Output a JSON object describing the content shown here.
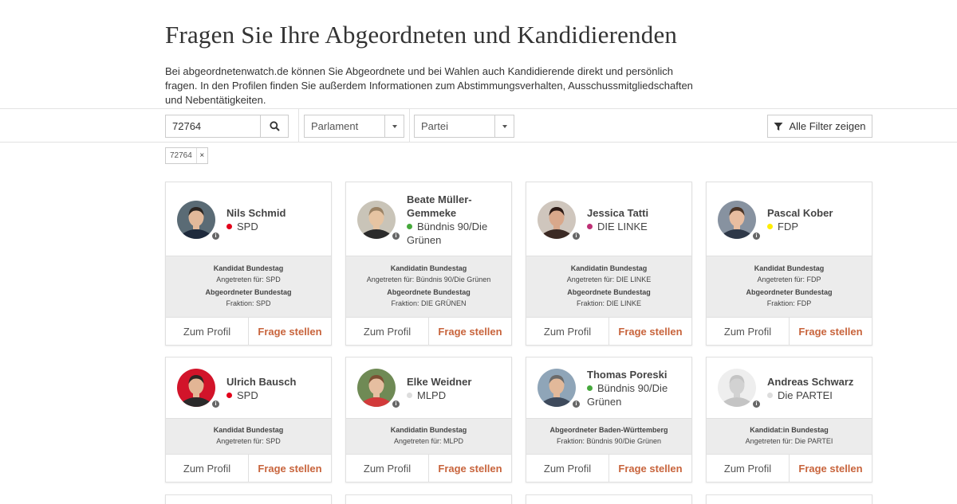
{
  "page": {
    "title": "Fragen Sie Ihre Abgeordneten und Kandidierenden",
    "intro": "Bei abgeordnetenwatch.de können Sie Abgeordnete und bei Wahlen auch Kandidierende direkt und persönlich fragen. In den Profilen finden Sie außerdem Informationen zum Abstimmungsverhalten, Ausschussmitgliedschaften und Nebentätigkeiten."
  },
  "filters": {
    "search_value": "72764",
    "search_icon": "search-icon",
    "parlament_label": "Parlament",
    "partei_label": "Partei",
    "all_filters_label": "Alle Filter zeigen",
    "filter_icon": "filter-icon",
    "chip_label": "72764",
    "chip_remove": "×"
  },
  "card_buttons": {
    "profile": "Zum Profil",
    "ask": "Frage stellen"
  },
  "colors": {
    "accent": "#c8643c",
    "spd": "#e2001a",
    "gruene": "#46a83c",
    "linke": "#be3075",
    "fdp": "#ffed00",
    "mlpd": "#dddddd",
    "partei": "#dddddd"
  },
  "cards": [
    {
      "name": "Nils Schmid",
      "party": "SPD",
      "party_color": "#e2001a",
      "roles": [
        {
          "title": "Kandidat Bundestag",
          "detail": "Angetreten für: SPD"
        },
        {
          "title": "Abgeordneter Bundestag",
          "detail": "Fraktion: SPD"
        }
      ]
    },
    {
      "name": "Beate Müller-Gemmeke",
      "party": "Bündnis 90/Die Grünen",
      "party_color": "#46a83c",
      "roles": [
        {
          "title": "Kandidatin Bundestag",
          "detail": "Angetreten für: Bündnis 90/Die Grünen"
        },
        {
          "title": "Abgeordnete Bundestag",
          "detail": "Fraktion: DIE GRÜNEN"
        }
      ]
    },
    {
      "name": "Jessica Tatti",
      "party": "DIE LINKE",
      "party_color": "#be3075",
      "roles": [
        {
          "title": "Kandidatin Bundestag",
          "detail": "Angetreten für: DIE LINKE"
        },
        {
          "title": "Abgeordnete Bundestag",
          "detail": "Fraktion: DIE LINKE"
        }
      ]
    },
    {
      "name": "Pascal Kober",
      "party": "FDP",
      "party_color": "#ffed00",
      "roles": [
        {
          "title": "Kandidat Bundestag",
          "detail": "Angetreten für: FDP"
        },
        {
          "title": "Abgeordneter Bundestag",
          "detail": "Fraktion: FDP"
        }
      ]
    },
    {
      "name": "Ulrich Bausch",
      "party": "SPD",
      "party_color": "#e2001a",
      "roles": [
        {
          "title": "Kandidat Bundestag",
          "detail": "Angetreten für: SPD"
        }
      ]
    },
    {
      "name": "Elke Weidner",
      "party": "MLPD",
      "party_color": "#dddddd",
      "roles": [
        {
          "title": "Kandidatin Bundestag",
          "detail": "Angetreten für: MLPD"
        }
      ]
    },
    {
      "name": "Thomas Poreski",
      "party": "Bündnis 90/Die Grünen",
      "party_color": "#46a83c",
      "roles": [
        {
          "title": "Abgeordneter Baden-Württemberg",
          "detail": "Fraktion: Bündnis 90/Die Grünen"
        }
      ]
    },
    {
      "name": "Andreas Schwarz",
      "party": "Die PARTEI",
      "party_color": "#dddddd",
      "roles": [
        {
          "title": "Kandidat:in Bundestag",
          "detail": "Angetreten für: Die PARTEI"
        }
      ]
    }
  ]
}
